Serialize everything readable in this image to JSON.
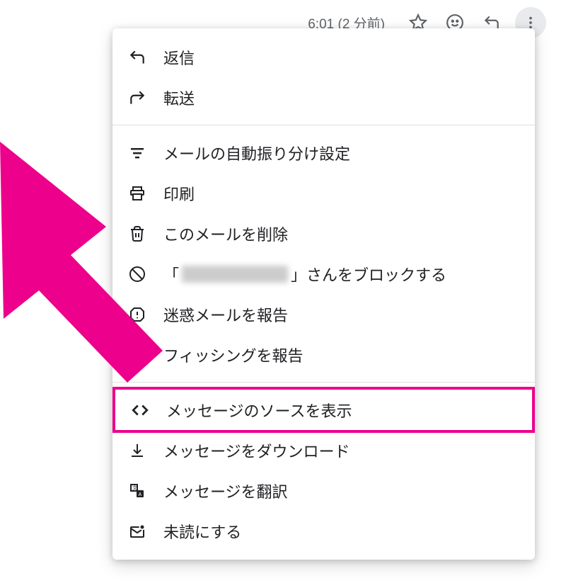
{
  "toolbar": {
    "timestamp": "6:01 (2 分前)"
  },
  "menu": {
    "reply": "返信",
    "forward": "転送",
    "filter": "メールの自動振り分け設定",
    "print": "印刷",
    "delete": "このメールを削除",
    "block_prefix": "「",
    "block_suffix": "」さんをブロックする",
    "report_spam": "迷惑メールを報告",
    "report_phishing": "フィッシングを報告",
    "show_original": "メッセージのソースを表示",
    "download": "メッセージをダウンロード",
    "translate": "メッセージを翻訳",
    "mark_unread": "未読にする"
  },
  "colors": {
    "accent": "#ec008c"
  }
}
